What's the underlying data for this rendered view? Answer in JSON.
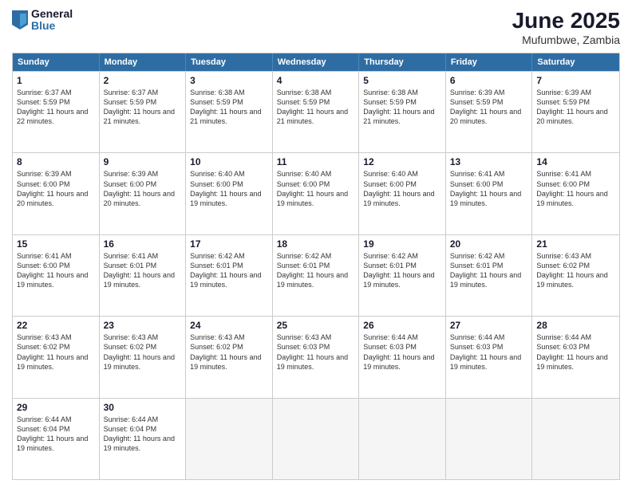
{
  "header": {
    "logo_general": "General",
    "logo_blue": "Blue",
    "month_title": "June 2025",
    "location": "Mufumbwe, Zambia"
  },
  "weekdays": [
    "Sunday",
    "Monday",
    "Tuesday",
    "Wednesday",
    "Thursday",
    "Friday",
    "Saturday"
  ],
  "rows": [
    [
      {
        "day": "1",
        "sunrise": "Sunrise: 6:37 AM",
        "sunset": "Sunset: 5:59 PM",
        "daylight": "Daylight: 11 hours and 22 minutes."
      },
      {
        "day": "2",
        "sunrise": "Sunrise: 6:37 AM",
        "sunset": "Sunset: 5:59 PM",
        "daylight": "Daylight: 11 hours and 21 minutes."
      },
      {
        "day": "3",
        "sunrise": "Sunrise: 6:38 AM",
        "sunset": "Sunset: 5:59 PM",
        "daylight": "Daylight: 11 hours and 21 minutes."
      },
      {
        "day": "4",
        "sunrise": "Sunrise: 6:38 AM",
        "sunset": "Sunset: 5:59 PM",
        "daylight": "Daylight: 11 hours and 21 minutes."
      },
      {
        "day": "5",
        "sunrise": "Sunrise: 6:38 AM",
        "sunset": "Sunset: 5:59 PM",
        "daylight": "Daylight: 11 hours and 21 minutes."
      },
      {
        "day": "6",
        "sunrise": "Sunrise: 6:39 AM",
        "sunset": "Sunset: 5:59 PM",
        "daylight": "Daylight: 11 hours and 20 minutes."
      },
      {
        "day": "7",
        "sunrise": "Sunrise: 6:39 AM",
        "sunset": "Sunset: 5:59 PM",
        "daylight": "Daylight: 11 hours and 20 minutes."
      }
    ],
    [
      {
        "day": "8",
        "sunrise": "Sunrise: 6:39 AM",
        "sunset": "Sunset: 6:00 PM",
        "daylight": "Daylight: 11 hours and 20 minutes."
      },
      {
        "day": "9",
        "sunrise": "Sunrise: 6:39 AM",
        "sunset": "Sunset: 6:00 PM",
        "daylight": "Daylight: 11 hours and 20 minutes."
      },
      {
        "day": "10",
        "sunrise": "Sunrise: 6:40 AM",
        "sunset": "Sunset: 6:00 PM",
        "daylight": "Daylight: 11 hours and 19 minutes."
      },
      {
        "day": "11",
        "sunrise": "Sunrise: 6:40 AM",
        "sunset": "Sunset: 6:00 PM",
        "daylight": "Daylight: 11 hours and 19 minutes."
      },
      {
        "day": "12",
        "sunrise": "Sunrise: 6:40 AM",
        "sunset": "Sunset: 6:00 PM",
        "daylight": "Daylight: 11 hours and 19 minutes."
      },
      {
        "day": "13",
        "sunrise": "Sunrise: 6:41 AM",
        "sunset": "Sunset: 6:00 PM",
        "daylight": "Daylight: 11 hours and 19 minutes."
      },
      {
        "day": "14",
        "sunrise": "Sunrise: 6:41 AM",
        "sunset": "Sunset: 6:00 PM",
        "daylight": "Daylight: 11 hours and 19 minutes."
      }
    ],
    [
      {
        "day": "15",
        "sunrise": "Sunrise: 6:41 AM",
        "sunset": "Sunset: 6:00 PM",
        "daylight": "Daylight: 11 hours and 19 minutes."
      },
      {
        "day": "16",
        "sunrise": "Sunrise: 6:41 AM",
        "sunset": "Sunset: 6:01 PM",
        "daylight": "Daylight: 11 hours and 19 minutes."
      },
      {
        "day": "17",
        "sunrise": "Sunrise: 6:42 AM",
        "sunset": "Sunset: 6:01 PM",
        "daylight": "Daylight: 11 hours and 19 minutes."
      },
      {
        "day": "18",
        "sunrise": "Sunrise: 6:42 AM",
        "sunset": "Sunset: 6:01 PM",
        "daylight": "Daylight: 11 hours and 19 minutes."
      },
      {
        "day": "19",
        "sunrise": "Sunrise: 6:42 AM",
        "sunset": "Sunset: 6:01 PM",
        "daylight": "Daylight: 11 hours and 19 minutes."
      },
      {
        "day": "20",
        "sunrise": "Sunrise: 6:42 AM",
        "sunset": "Sunset: 6:01 PM",
        "daylight": "Daylight: 11 hours and 19 minutes."
      },
      {
        "day": "21",
        "sunrise": "Sunrise: 6:43 AM",
        "sunset": "Sunset: 6:02 PM",
        "daylight": "Daylight: 11 hours and 19 minutes."
      }
    ],
    [
      {
        "day": "22",
        "sunrise": "Sunrise: 6:43 AM",
        "sunset": "Sunset: 6:02 PM",
        "daylight": "Daylight: 11 hours and 19 minutes."
      },
      {
        "day": "23",
        "sunrise": "Sunrise: 6:43 AM",
        "sunset": "Sunset: 6:02 PM",
        "daylight": "Daylight: 11 hours and 19 minutes."
      },
      {
        "day": "24",
        "sunrise": "Sunrise: 6:43 AM",
        "sunset": "Sunset: 6:02 PM",
        "daylight": "Daylight: 11 hours and 19 minutes."
      },
      {
        "day": "25",
        "sunrise": "Sunrise: 6:43 AM",
        "sunset": "Sunset: 6:03 PM",
        "daylight": "Daylight: 11 hours and 19 minutes."
      },
      {
        "day": "26",
        "sunrise": "Sunrise: 6:44 AM",
        "sunset": "Sunset: 6:03 PM",
        "daylight": "Daylight: 11 hours and 19 minutes."
      },
      {
        "day": "27",
        "sunrise": "Sunrise: 6:44 AM",
        "sunset": "Sunset: 6:03 PM",
        "daylight": "Daylight: 11 hours and 19 minutes."
      },
      {
        "day": "28",
        "sunrise": "Sunrise: 6:44 AM",
        "sunset": "Sunset: 6:03 PM",
        "daylight": "Daylight: 11 hours and 19 minutes."
      }
    ],
    [
      {
        "day": "29",
        "sunrise": "Sunrise: 6:44 AM",
        "sunset": "Sunset: 6:04 PM",
        "daylight": "Daylight: 11 hours and 19 minutes."
      },
      {
        "day": "30",
        "sunrise": "Sunrise: 6:44 AM",
        "sunset": "Sunset: 6:04 PM",
        "daylight": "Daylight: 11 hours and 19 minutes."
      },
      null,
      null,
      null,
      null,
      null
    ]
  ]
}
